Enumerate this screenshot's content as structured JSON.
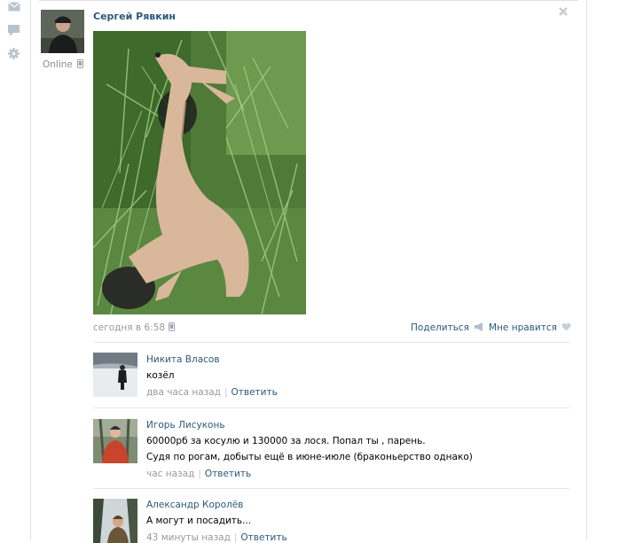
{
  "sidebar_icons": [
    "mail-icon",
    "chat-bubble-icon",
    "gear-icon"
  ],
  "post": {
    "author": "Сергей Рявкин",
    "online_status": "Online",
    "date": "сегодня в 6:58",
    "share_label": "Поделиться",
    "like_label": "Мне нравится"
  },
  "comments": [
    {
      "name": "Никита Власов",
      "lines": [
        "козёл"
      ],
      "time": "два часа назад",
      "reply": "Ответить"
    },
    {
      "name": "Игорь Лисуконь",
      "lines": [
        "60000рб за косулю и 130000 за лося. Попал ты , парень.",
        "Судя по рогам, добыты ещё в июне-июле (браконьерство однако)"
      ],
      "time": "час назад",
      "reply": "Ответить"
    },
    {
      "name": "Александр Королёв",
      "lines": [
        "А могут и посадить..."
      ],
      "time": "43 минуты назад",
      "reply": "Ответить"
    }
  ],
  "colors": {
    "link": "#2b587a",
    "muted": "#999999",
    "border": "#dfe3e8"
  }
}
